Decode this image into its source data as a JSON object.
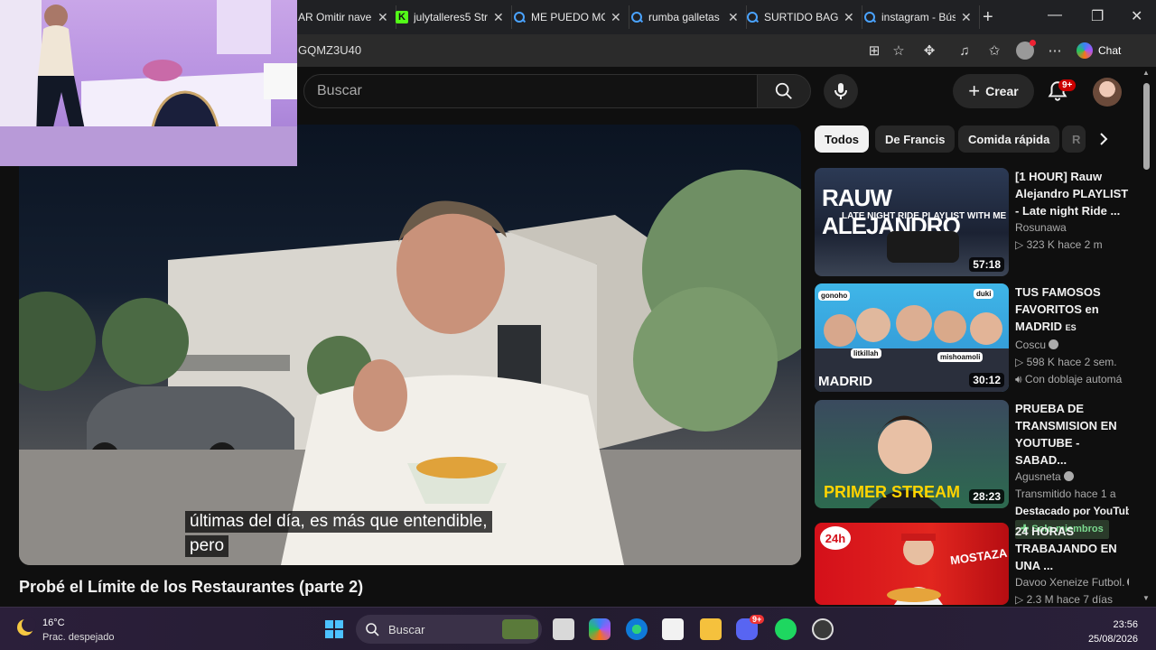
{
  "browser": {
    "tabs": [
      {
        "title": "AR Omitir nave",
        "icon": "search-icon"
      },
      {
        "title": "julytalleres5 Str",
        "icon": "kick-icon"
      },
      {
        "title": "ME PUEDO MO",
        "icon": "search-icon"
      },
      {
        "title": "rumba galletas",
        "icon": "search-icon"
      },
      {
        "title": "SURTIDO BAGL",
        "icon": "search-icon"
      },
      {
        "title": "instagram - Bús",
        "icon": "search-icon"
      }
    ],
    "url_fragment": "GQMZ3U40",
    "chat_label": "Chat"
  },
  "youtube": {
    "search_placeholder": "Buscar",
    "create_label": "Crear",
    "notification_count": "9+"
  },
  "video": {
    "caption_line1": "últimas del día, es más que entendible,",
    "caption_line2": "pero",
    "title": "Probé el Límite de los Restaurantes (parte 2)"
  },
  "chips": [
    "Todos",
    "De Francis",
    "Comida rápida",
    "R"
  ],
  "recommendations": [
    {
      "title_lines": [
        "[1 HOUR] Rauw",
        "Alejandro PLAYLIST",
        "- Late night Ride ..."
      ],
      "channel": "Rosunawa",
      "stats": "▷ 323 K  hace 2 m",
      "duration": "57:18",
      "thumb_text_main": "RAUW ALEJANDRO",
      "thumb_text_sub": "LATE NIGHT RIDE PLAYLIST WITH ME"
    },
    {
      "title_lines": [
        "TUS FAMOSOS",
        "FAVORITOS en",
        "MADRID"
      ],
      "title_suffix": "ES",
      "channel": "Coscu",
      "stats": "▷ 598 K  hace 2 sem.",
      "extra": "Con doblaje automá",
      "duration": "30:12",
      "thumb_text_main": "MADRID",
      "thumb_tags": [
        "gonoho",
        "duki",
        "litkillah",
        "mishoamoli"
      ]
    },
    {
      "title_lines": [
        "PRUEBA DE",
        "TRANSMISION EN",
        "YOUTUBE - SABAD..."
      ],
      "channel": "Agusneta",
      "stats": "Transmitido hace 1 a",
      "extra": "Destacado por YouTube",
      "members": "Solo miembros",
      "duration": "28:23",
      "thumb_text_main": "PRIMER STREAM"
    },
    {
      "title_lines": [
        "24 HORAS",
        "TRABAJANDO EN",
        "UNA ..."
      ],
      "channel": "Davoo Xeneize Futbol.",
      "stats": "▷ 2.3 M  hace 7 días",
      "thumb_text_main": "24h",
      "thumb_text_sub": "MOSTAZA"
    }
  ],
  "taskbar": {
    "temperature": "16°C",
    "condition": "Prac. despejado",
    "search_label": "Buscar",
    "discord_badge": "9+",
    "time": "23:56",
    "date": "25/08/2026"
  }
}
